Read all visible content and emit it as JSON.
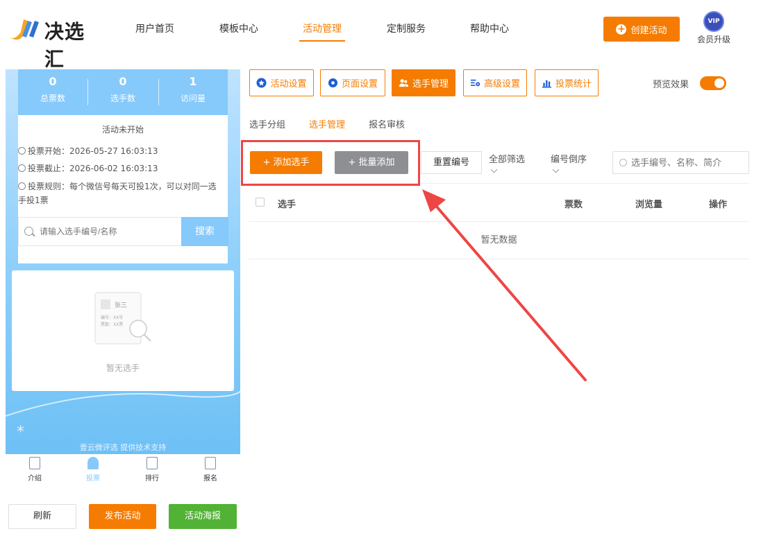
{
  "header": {
    "logo_text": "决选汇",
    "nav": [
      {
        "label": "用户首页",
        "active": false
      },
      {
        "label": "模板中心",
        "active": false
      },
      {
        "label": "活动管理",
        "active": true
      },
      {
        "label": "定制服务",
        "active": false
      },
      {
        "label": "帮助中心",
        "active": false
      }
    ],
    "create_button": "创建活动",
    "vip_badge": "VIP",
    "vip_label": "会员升级"
  },
  "preview": {
    "stats": [
      {
        "value": "0",
        "label": "总票数"
      },
      {
        "value": "0",
        "label": "选手数"
      },
      {
        "value": "1",
        "label": "访问量"
      }
    ],
    "status": "活动未开始",
    "vote_start": "投票开始：2026-05-27 16:03:13",
    "vote_end": "投票截止：2026-06-02 16:03:13",
    "vote_rules": "投票规则：每个微信号每天可投1次，可以对同一选手投1票",
    "search_placeholder": "请输入选手编号/名称",
    "search_button": "搜索",
    "empty_illus": {
      "name": "张三",
      "id_line": "编号：XX号",
      "votes_line": "票数：XX票"
    },
    "empty_text": "暂无选手",
    "support_text": "壹云微评选 提供技术支持",
    "bottom_nav": [
      {
        "label": "介绍",
        "active": false
      },
      {
        "label": "投票",
        "active": true
      },
      {
        "label": "排行",
        "active": false
      },
      {
        "label": "报名",
        "active": false
      }
    ]
  },
  "actions": {
    "refresh": "刷新",
    "publish": "发布活动",
    "poster": "活动海报"
  },
  "settings_tabs": [
    {
      "label": "活动设置",
      "active": false
    },
    {
      "label": "页面设置",
      "active": false
    },
    {
      "label": "选手管理",
      "active": true
    },
    {
      "label": "高级设置",
      "active": false
    },
    {
      "label": "投票统计",
      "active": false
    }
  ],
  "preview_toggle": {
    "label": "预览效果",
    "on": true
  },
  "subtabs": [
    {
      "label": "选手分组",
      "active": false
    },
    {
      "label": "选手管理",
      "active": true
    },
    {
      "label": "报名审核",
      "active": false
    }
  ],
  "toolbar": {
    "add_player": "+ 添加选手",
    "batch_add": "+ 批量添加",
    "reset_numbers": "重置编号",
    "filter_all": "全部筛选",
    "sort_desc": "编号倒序",
    "search_placeholder": "选手编号、名称、简介"
  },
  "table": {
    "columns": [
      "选手",
      "票数",
      "浏览量",
      "操作"
    ],
    "empty_text": "暂无数据"
  },
  "colors": {
    "accent": "#f57c00",
    "preview_blue": "#86c9fb",
    "green": "#52b236",
    "annotation_red": "#ee4545"
  }
}
